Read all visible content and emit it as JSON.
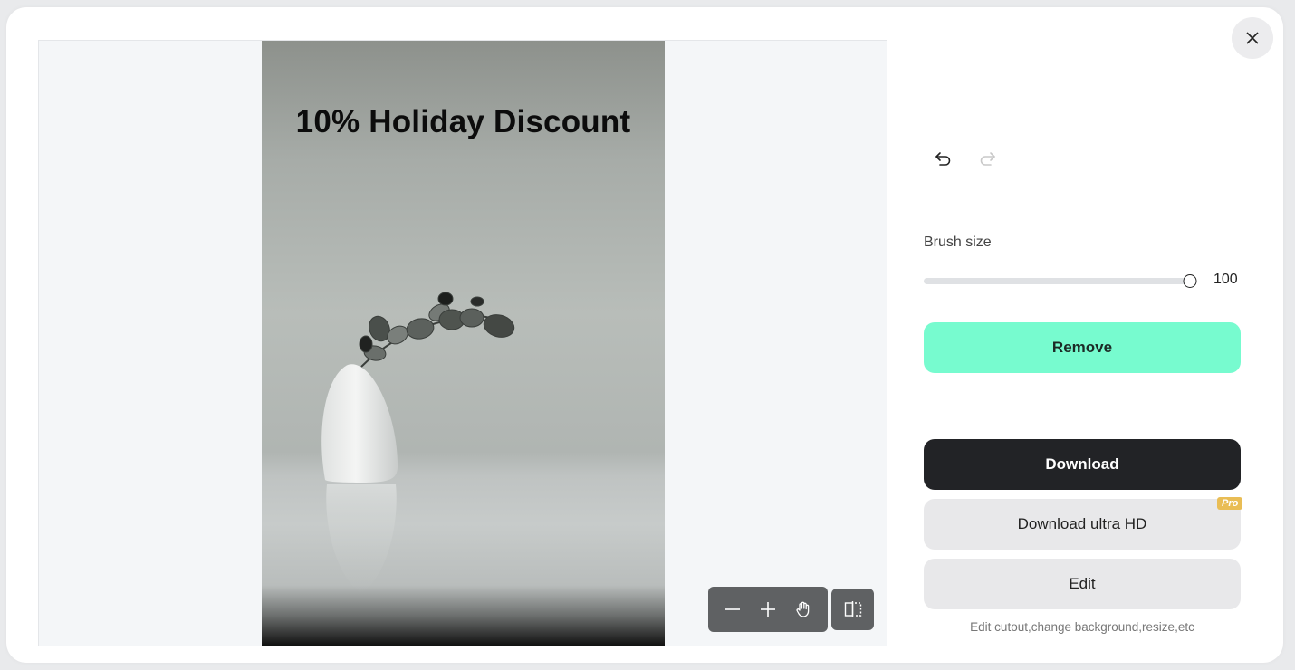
{
  "dialog": {
    "close_icon": "close-icon"
  },
  "preview": {
    "image_title_text": "10% Holiday Discount",
    "image_description": "white vase with eucalyptus branch on white table",
    "toolbar": {
      "zoom_out_icon": "minus-icon",
      "zoom_in_icon": "plus-icon",
      "pan_icon": "hand-icon",
      "compare_icon": "compare-split-icon"
    }
  },
  "history": {
    "undo_icon": "undo-icon",
    "redo_icon": "redo-icon",
    "redo_enabled": false
  },
  "brush": {
    "label": "Brush size",
    "value": "100",
    "min": 0,
    "max": 100
  },
  "actions": {
    "remove_label": "Remove",
    "download_label": "Download",
    "download_hd_label": "Download ultra HD",
    "pro_badge": "Pro",
    "edit_label": "Edit",
    "edit_hint": "Edit cutout,change background,resize,etc"
  },
  "colors": {
    "remove_accent": "#77fbcf",
    "download_bg": "#222326",
    "pro_badge": "#e9bd55"
  }
}
